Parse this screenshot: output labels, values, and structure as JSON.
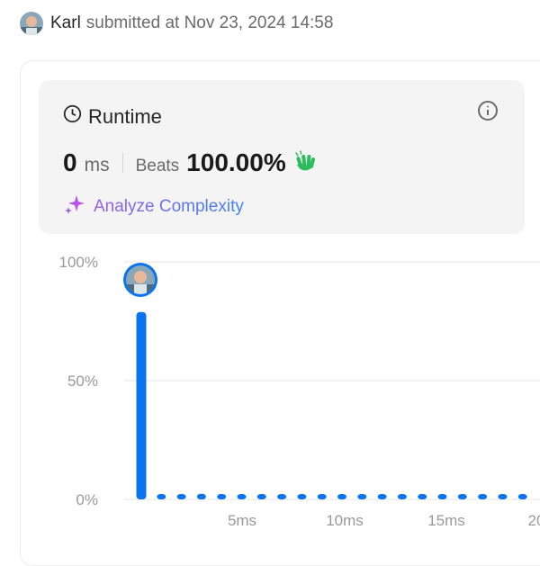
{
  "header": {
    "author": "Karl",
    "submitted_text": "submitted at Nov 23, 2024 14:58"
  },
  "runtime": {
    "title": "Runtime",
    "value": "0",
    "unit": "ms",
    "beats_label": "Beats",
    "beats_value": "100.00%",
    "analyze_label": "Analyze Complexity"
  },
  "icons": {
    "clock": "clock-icon",
    "info": "info-icon",
    "clap": "clapping-hands-icon",
    "sparkle": "sparkle-icon"
  },
  "colors": {
    "bar": "#0a74f0",
    "beats_icon": "#2cbb5d",
    "analyze_start": "#9b5de5",
    "analyze_end": "#3b82f6"
  },
  "chart_data": {
    "type": "bar",
    "y_ticks": [
      "100%",
      "50%",
      "0%"
    ],
    "x_ticks": [
      "5ms",
      "10ms",
      "15ms",
      "20"
    ],
    "ylim": [
      0,
      100
    ],
    "values": [
      78.5,
      1.5,
      1.5,
      2,
      1.5,
      1.5,
      1.5,
      1.5,
      1.5,
      1.5,
      1.5,
      1.5,
      1.5,
      1.5,
      1.5,
      1.5,
      1.5,
      1.5,
      1.5,
      1.5
    ],
    "highlighted_index": 0
  }
}
